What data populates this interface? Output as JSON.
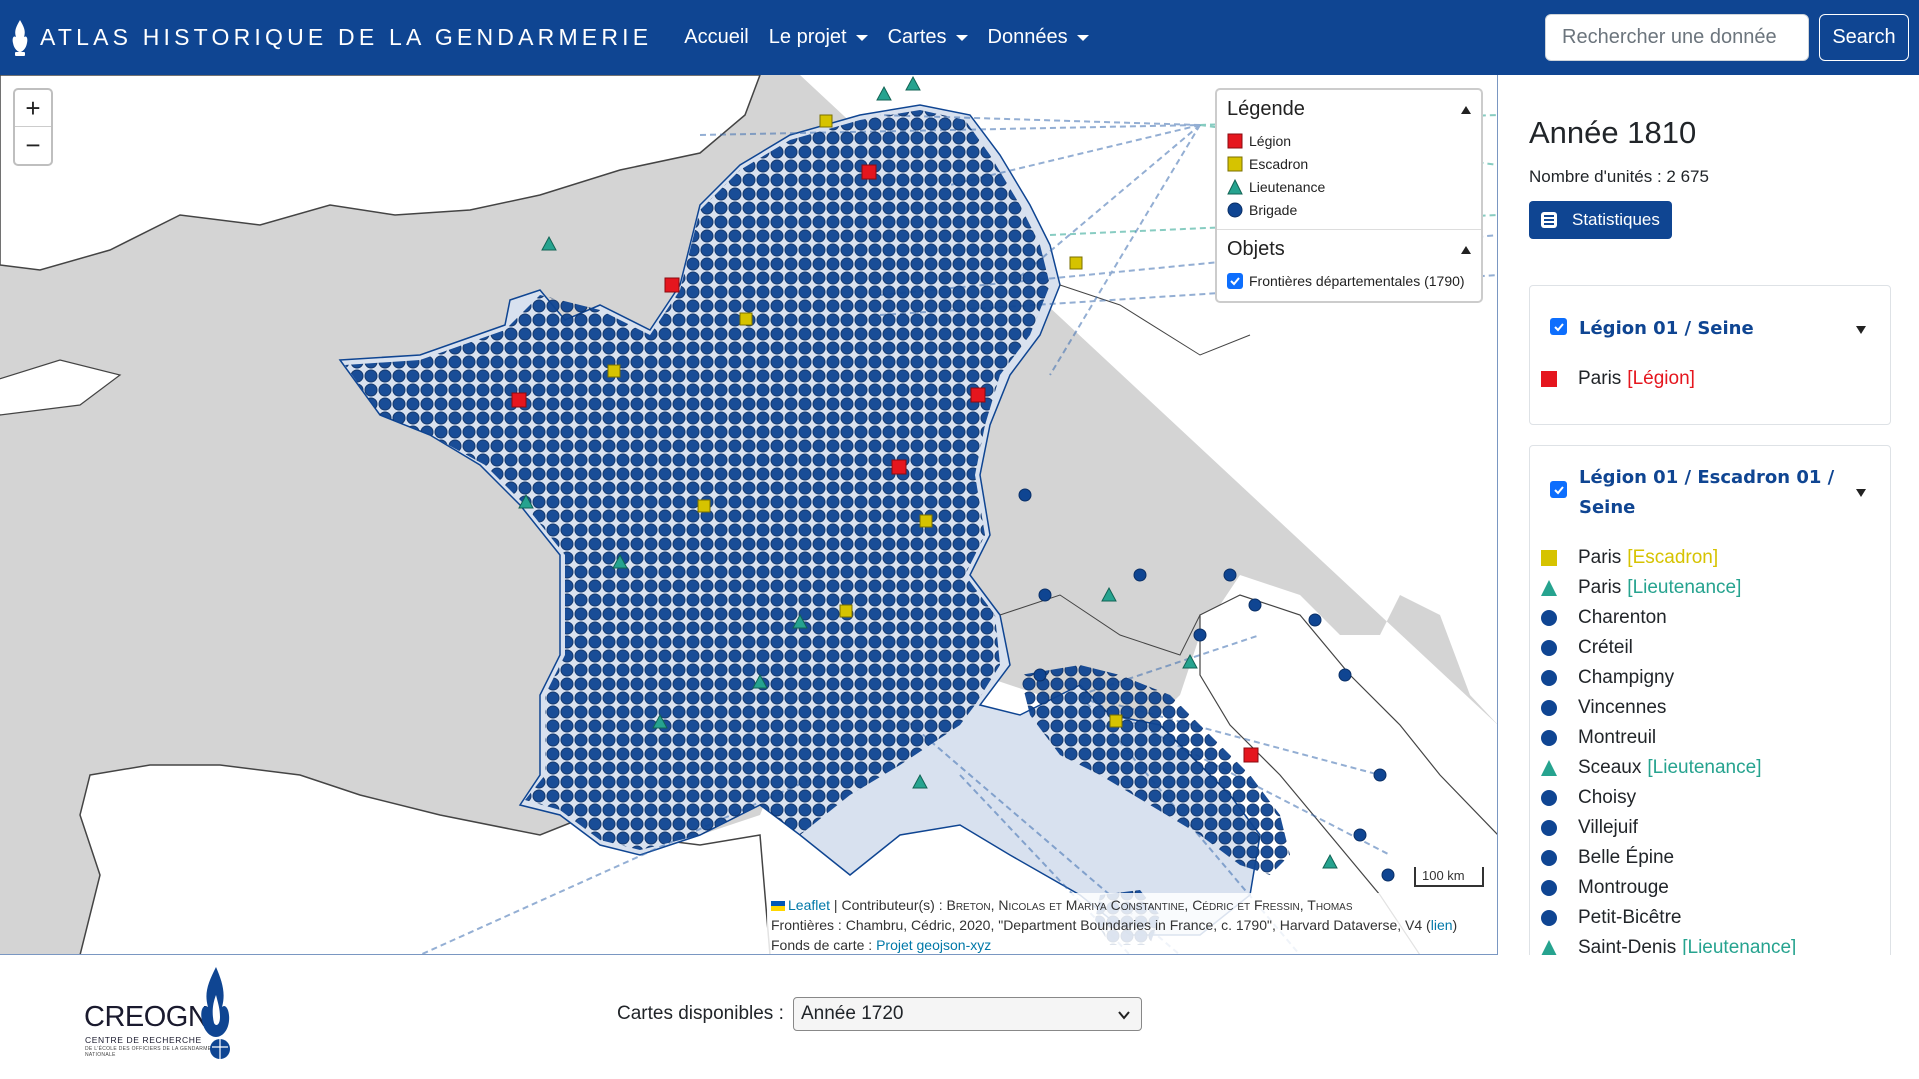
{
  "navbar": {
    "brand": "ATLAS HISTORIQUE DE LA GENDARMERIE",
    "items": [
      {
        "label": "Accueil",
        "dropdown": false
      },
      {
        "label": "Le projet",
        "dropdown": true
      },
      {
        "label": "Cartes",
        "dropdown": true
      },
      {
        "label": "Données",
        "dropdown": true
      }
    ],
    "search_placeholder": "Rechercher une donnée",
    "search_button": "Search"
  },
  "map": {
    "zoom_in": "+",
    "zoom_out": "−",
    "legend": {
      "title": "Légende",
      "items": [
        {
          "label": "Légion",
          "symbol": "square",
          "color": "#e5161e"
        },
        {
          "label": "Escadron",
          "symbol": "square",
          "color": "#d6c300"
        },
        {
          "label": "Lieutenance",
          "symbol": "triangle",
          "color": "#26a38f"
        },
        {
          "label": "Brigade",
          "symbol": "circle",
          "color": "#0f4592"
        }
      ],
      "objects_title": "Objets",
      "objects": [
        {
          "label": "Frontières départementales (1790)",
          "checked": true
        }
      ]
    },
    "scale": "100 km",
    "attribution": {
      "leaflet": "Leaflet",
      "contrib_prefix": " | Contributeur(s) : ",
      "contributors": "Breton, Nicolas et Mariya Constantine, Cédric et Fressin, Thomas",
      "frontieres_prefix": "Frontières : ",
      "frontieres": "Chambru, Cédric, 2020, \"Department Boundaries in France, c. 1790\", Harvard Dataverse, V4",
      "lien": "lien",
      "fonds_prefix": "Fonds de carte : ",
      "fonds_link": "Projet geojson-xyz"
    }
  },
  "sidebar": {
    "year": "Année 1810",
    "count": "Nombre d'unités : 2 675",
    "stats_button": "Statistiques",
    "cards": [
      {
        "title": "Légion 01 / Seine",
        "units": [
          {
            "name": "Paris",
            "type": "[Légion]",
            "kind": "legion"
          }
        ]
      },
      {
        "title": "Légion 01 / Escadron 01 / Seine",
        "units": [
          {
            "name": "Paris",
            "type": "[Escadron]",
            "kind": "escadron"
          },
          {
            "name": "Paris",
            "type": "[Lieutenance]",
            "kind": "lieutenance"
          },
          {
            "name": "Charenton",
            "type": "",
            "kind": "brigade"
          },
          {
            "name": "Créteil",
            "type": "",
            "kind": "brigade"
          },
          {
            "name": "Champigny",
            "type": "",
            "kind": "brigade"
          },
          {
            "name": "Vincennes",
            "type": "",
            "kind": "brigade"
          },
          {
            "name": "Montreuil",
            "type": "",
            "kind": "brigade"
          },
          {
            "name": "Sceaux",
            "type": "[Lieutenance]",
            "kind": "lieutenance"
          },
          {
            "name": "Choisy",
            "type": "",
            "kind": "brigade"
          },
          {
            "name": "Villejuif",
            "type": "",
            "kind": "brigade"
          },
          {
            "name": "Belle Épine",
            "type": "",
            "kind": "brigade"
          },
          {
            "name": "Montrouge",
            "type": "",
            "kind": "brigade"
          },
          {
            "name": "Petit-Bicêtre",
            "type": "",
            "kind": "brigade"
          },
          {
            "name": "Saint-Denis",
            "type": "[Lieutenance]",
            "kind": "lieutenance"
          }
        ]
      }
    ]
  },
  "footer": {
    "logo_name": "CREOGN",
    "logo_sub": "CENTRE DE RECHERCHE",
    "logo_sub2": "DE L'ÉCOLE DES OFFICIERS DE LA GENDARMERIE NATIONALE",
    "maps_label": "Cartes disponibles :",
    "maps_selected": "Année 1720"
  },
  "colors": {
    "navbar": "#0f4592",
    "legion": "#e5161e",
    "escadron": "#d6c300",
    "lieutenance": "#26a38f",
    "brigade": "#0f4592"
  }
}
